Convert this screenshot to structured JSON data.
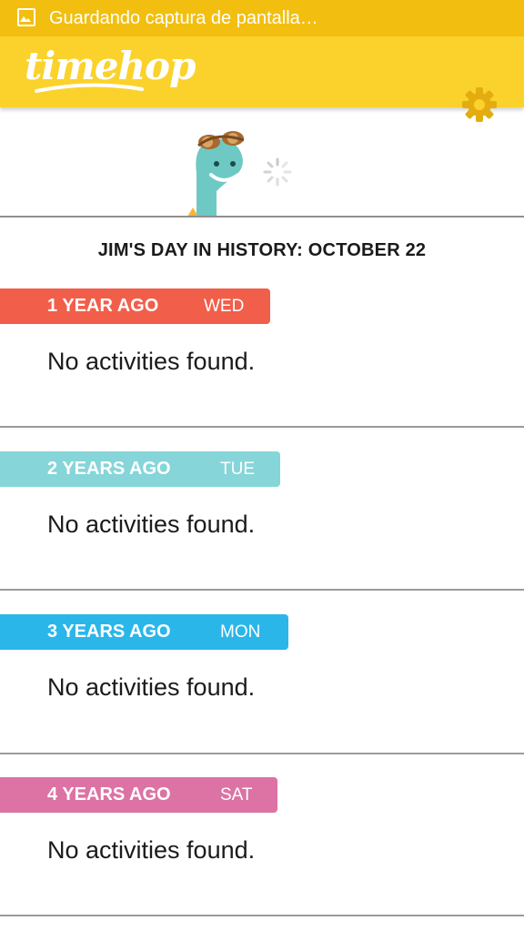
{
  "status_bar": {
    "icon": "image-icon",
    "text": "Guardando captura de pantalla…",
    "color": "#f2bf10"
  },
  "app_bar": {
    "logo_text": "timehop",
    "settings_icon": "gear-icon",
    "color": "#fbd22c"
  },
  "header": {
    "title": "JIM'S DAY IN HISTORY: OCTOBER 22"
  },
  "years": [
    {
      "ago": "1 YEAR AGO",
      "day": "WED",
      "color": "#f15e4a",
      "empty": "No activities found."
    },
    {
      "ago": "2 YEARS AGO",
      "day": "TUE",
      "color": "#86d5d9",
      "empty": "No activities found."
    },
    {
      "ago": "3 YEARS AGO",
      "day": "MON",
      "color": "#2bb6e9",
      "empty": "No activities found."
    },
    {
      "ago": "4 YEARS AGO",
      "day": "SAT",
      "color": "#dc73a4",
      "empty": "No activities found."
    }
  ]
}
